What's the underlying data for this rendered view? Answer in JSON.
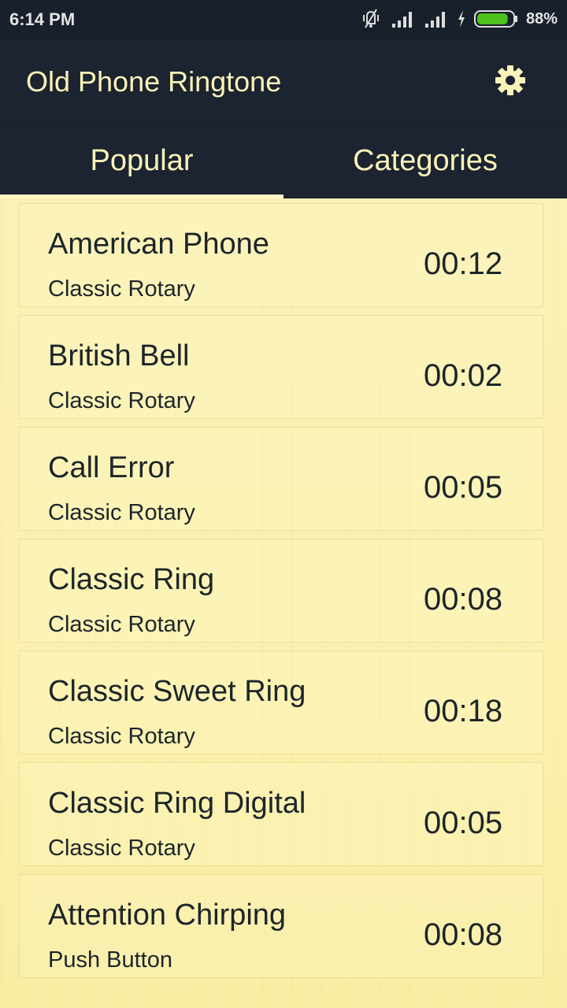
{
  "status_bar": {
    "time": "6:14 PM",
    "battery_percent": "88%",
    "battery_level": 0.88,
    "icons": [
      "vibrate-off-icon",
      "signal-icon",
      "signal-icon",
      "charging-bolt-icon",
      "battery-icon"
    ]
  },
  "app_bar": {
    "title": "Old Phone Ringtone",
    "settings_icon": "gear-icon"
  },
  "tabs": [
    {
      "label": "Popular",
      "selected": true
    },
    {
      "label": "Categories",
      "selected": false
    }
  ],
  "colors": {
    "bar_bg": "#1b2430",
    "accent_text": "#fbf3b8",
    "list_bg": "#fbf1b6",
    "item_text": "#1c2529",
    "battery_green": "#4cc21a"
  },
  "ringtones": [
    {
      "name": "American Phone",
      "category": "Classic Rotary",
      "duration": "00:12"
    },
    {
      "name": "British Bell",
      "category": "Classic Rotary",
      "duration": "00:02"
    },
    {
      "name": "Call Error",
      "category": "Classic Rotary",
      "duration": "00:05"
    },
    {
      "name": "Classic Ring",
      "category": "Classic Rotary",
      "duration": "00:08"
    },
    {
      "name": "Classic Sweet Ring",
      "category": "Classic Rotary",
      "duration": "00:18"
    },
    {
      "name": "Classic Ring Digital",
      "category": "Classic Rotary",
      "duration": "00:05"
    },
    {
      "name": "Attention Chirping",
      "category": "Push Button",
      "duration": "00:08"
    }
  ]
}
